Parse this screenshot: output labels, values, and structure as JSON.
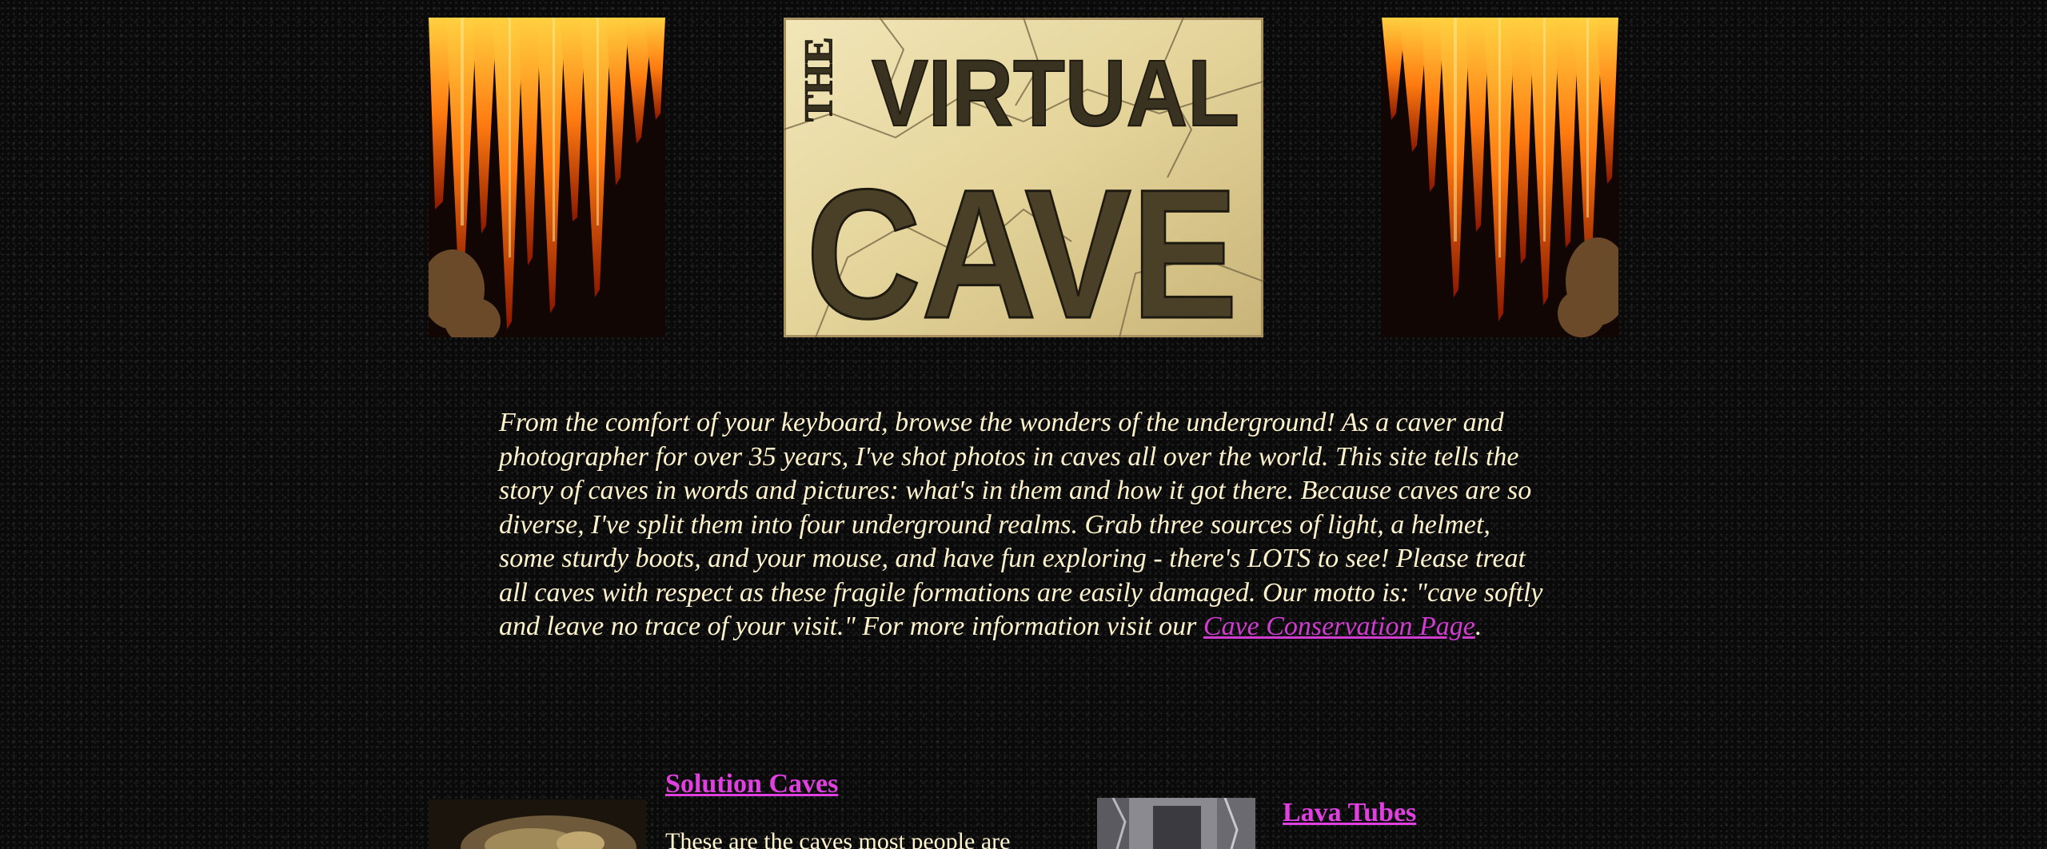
{
  "banner": {
    "logo_the": "THE",
    "logo_virtual": "VIRTUAL",
    "logo_cave": "CAVE"
  },
  "intro": {
    "text": "From the comfort of your keyboard, browse the wonders of the underground! As a caver and photographer for over 35 years, I've shot photos in caves all over the world. This site tells the story of caves in words and pictures: what's in them and how it got there. Because caves are so diverse, I've split them into four underground realms. Grab three sources of light, a helmet, some sturdy boots, and your mouse, and have fun exploring - there's LOTS to see! Please treat all caves with respect as these fragile formations are easily damaged. Our motto is: \"cave softly and leave no trace of your visit.\" For more information visit our ",
    "link_label": "Cave Conservation Page",
    "end": "."
  },
  "realms": {
    "solution": {
      "title": "Solution Caves",
      "text": "These are the caves most people are"
    },
    "lava": {
      "title": "Lava Tubes"
    }
  },
  "colors": {
    "text": "#fff3cc",
    "link": "#e040e0",
    "background": "#0a0a0a"
  }
}
